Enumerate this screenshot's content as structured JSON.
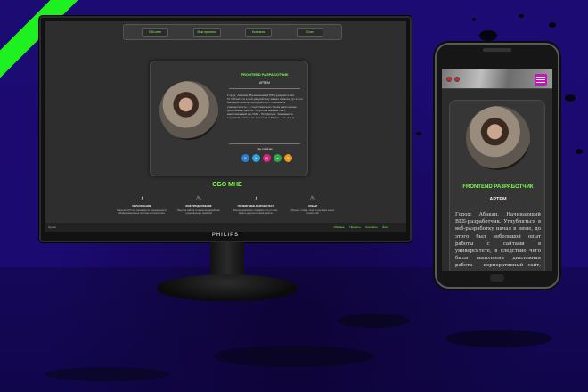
{
  "monitor": {
    "brand": "PHILIPS",
    "nav": [
      "Обо мне",
      "Мои проекты",
      "Контакты",
      "Блог"
    ],
    "card": {
      "role": "FRONTEND РАЗРАБОТЧИК",
      "name": "АРТЕМ",
      "bio": "Город: Абакан. Начинающий ВЕБ-разработчик. Углубляться в веб-разработку начал в июле, до этого был небольшой опыт работы с сайтами в университете, в следствие чего была выполнена дипломная работа - корпоративный сайт, выполненный на CMS - Wordpress. Занимаюсь версткой сайтов по макетам в Figma, тех. и т.д.",
      "contacts_label": "Где я сейчас",
      "socials": [
        {
          "icon": "vk-icon",
          "glyph": "В",
          "color": "#2a7dd6"
        },
        {
          "icon": "telegram-icon",
          "glyph": "➤",
          "color": "#2aa3e0"
        },
        {
          "icon": "instagram-icon",
          "glyph": "◎",
          "color": "#d6247a"
        },
        {
          "icon": "github-icon",
          "glyph": "●",
          "color": "#2fa84a"
        },
        {
          "icon": "habr-icon",
          "glyph": "✎",
          "color": "#e89a1a"
        }
      ]
    },
    "about_title": "ОБО МНЕ",
    "features": [
      {
        "icon": "guitar-icon",
        "glyph": "♪",
        "title": "ОБРАЗОВАНИЕ",
        "desc": "Закончил ХГУ им. Катанова по специальности «Информационные системы и технологии»"
      },
      {
        "icon": "fire-icon",
        "glyph": "♨",
        "title": "МОЁ ПРЕДЛОЖЕНИЕ",
        "desc": "Верстка сайтов по макетам, доработка существующих проектов"
      },
      {
        "icon": "guitar-icon",
        "glyph": "♪",
        "title": "ПОЧЕМУ WEB-РАЗРАБОТКА?",
        "desc": "Всегда нравилось создавать что-то своё, видеть результат своей работы"
      },
      {
        "icon": "fire-icon",
        "glyph": "♨",
        "title": "ХОББИ",
        "desc": "Музыка, гитара, спорт и изучение новых технологий"
      }
    ],
    "footer_label": "Артем",
    "footer_items": [
      "Обо мне",
      "Проекты",
      "Контакты",
      "Блог"
    ]
  },
  "phone": {
    "role": "FRONTEND РАЗРАБОТЧИК",
    "name": "АРТЕМ",
    "bio": "Город: Абакан. Начинающий ВЕБ-разработчик. Углубляться в веб-разработку начал в июле, до этого был небольшой опыт работы с сайтами в университете, в следствие чего была выполнена дипломная работа - корпоративный сайт, выполненный на CMS - Wordpress. Занимаюсь версткой сайтов как по макетам в Figma, так и в"
  },
  "colors": {
    "accent": "#7dff4a",
    "background": "#1a0a6b",
    "stripe": "#1ff01f",
    "menu": "#c018b8"
  }
}
